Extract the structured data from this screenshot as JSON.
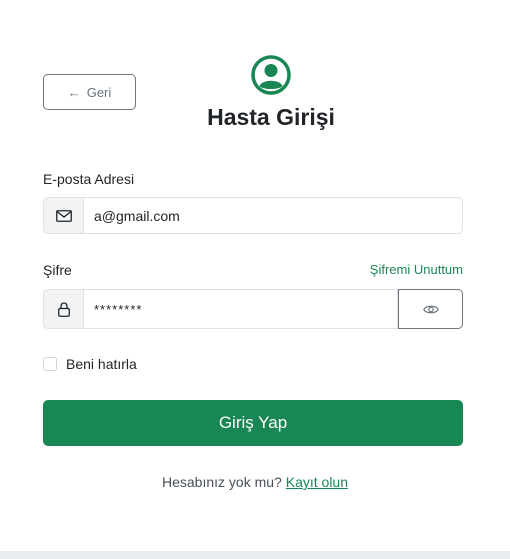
{
  "header": {
    "back_label": "Geri",
    "back_arrow": "←",
    "title": "Hasta Girişi",
    "icon": "user-circle-icon"
  },
  "form": {
    "email_label": "E-posta Adresi",
    "email_value": "a@gmail.com",
    "email_icon": "envelope-icon",
    "password_label": "Şifre",
    "forgot_label": "Şifremi Unuttum",
    "password_value": "********",
    "password_icon": "lock-icon",
    "toggle_icon": "eye-icon",
    "remember_label": "Beni hatırla",
    "remember_checked": false,
    "submit_label": "Giriş Yap"
  },
  "footer": {
    "prompt": "Hesabınız yok mu?",
    "signup_label": "Kayıt olun"
  },
  "colors": {
    "primary": "#198754",
    "secondary": "#6c757d",
    "border": "#dee2e6",
    "addon_bg": "#f1f3f5"
  }
}
